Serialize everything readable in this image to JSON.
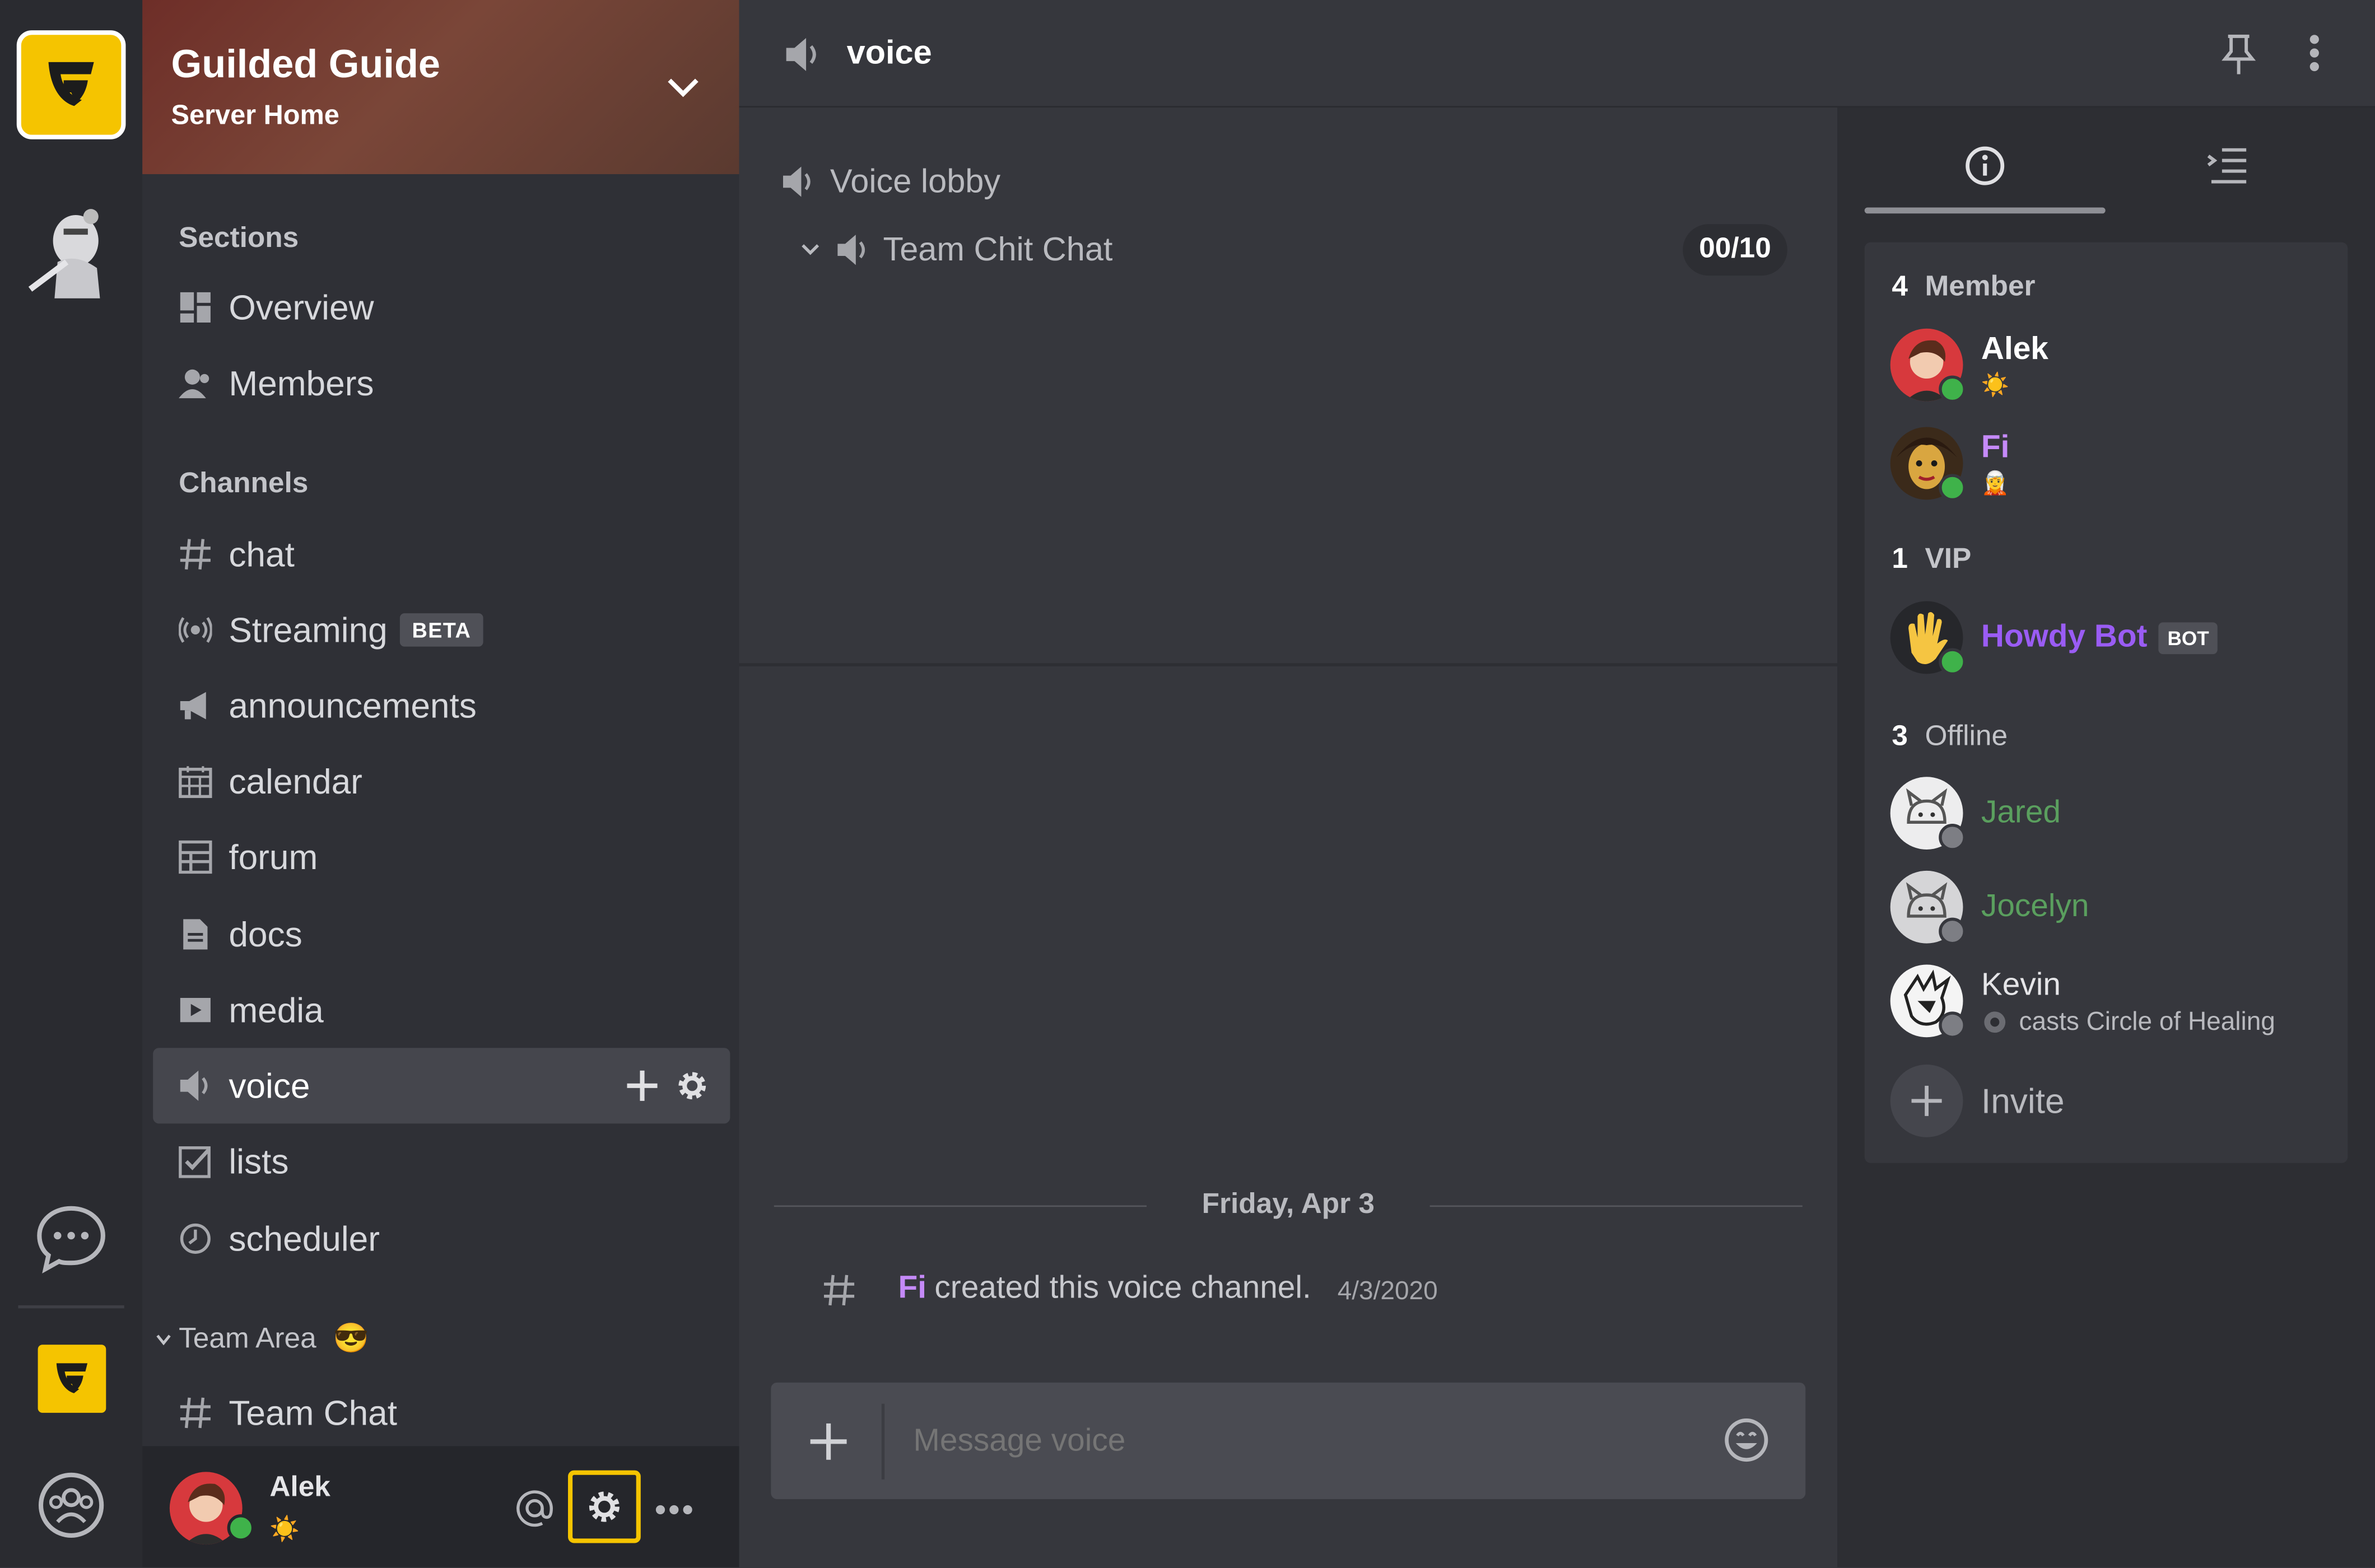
{
  "server": {
    "name": "Guilded Guide",
    "subtitle": "Server Home"
  },
  "sidebar": {
    "sections_header": "Sections",
    "sections": [
      {
        "label": "Overview",
        "icon": "overview-icon"
      },
      {
        "label": "Members",
        "icon": "members-icon"
      }
    ],
    "channels_header": "Channels",
    "channels": [
      {
        "label": "chat",
        "icon": "hash-icon"
      },
      {
        "label": "Streaming",
        "icon": "streaming-icon",
        "badge": "BETA"
      },
      {
        "label": "announcements",
        "icon": "megaphone-icon"
      },
      {
        "label": "calendar",
        "icon": "calendar-icon"
      },
      {
        "label": "forum",
        "icon": "forum-icon"
      },
      {
        "label": "docs",
        "icon": "docs-icon"
      },
      {
        "label": "media",
        "icon": "media-icon"
      },
      {
        "label": "voice",
        "icon": "speaker-icon",
        "selected": true
      },
      {
        "label": "lists",
        "icon": "checkbox-icon"
      },
      {
        "label": "scheduler",
        "icon": "clock-icon"
      }
    ],
    "team_area": {
      "label": "Team Area",
      "emoji": "😎"
    },
    "team_channels": [
      {
        "label": "Team Chat",
        "icon": "hash-icon"
      }
    ]
  },
  "user": {
    "name": "Alek",
    "status_emoji": "☀️"
  },
  "topbar": {
    "channel": "voice"
  },
  "voice": {
    "lobby_label": "Voice lobby",
    "room_label": "Team Chit Chat",
    "room_count": "00/10"
  },
  "chat": {
    "date_divider": "Friday, Apr 3",
    "system_author": "Fi",
    "system_text": "created this voice channel.",
    "system_date": "4/3/2020"
  },
  "composer": {
    "placeholder": "Message voice"
  },
  "members": {
    "group_member": {
      "count": "4",
      "label": "Member"
    },
    "group_vip": {
      "count": "1",
      "label": "VIP"
    },
    "group_offline": {
      "count": "3",
      "label": "Offline"
    },
    "online": [
      {
        "name": "Alek",
        "status": "☀️"
      },
      {
        "name": "Fi",
        "status": "🧝"
      }
    ],
    "vip": [
      {
        "name": "Howdy Bot",
        "badge": "BOT"
      }
    ],
    "offline": [
      {
        "name": "Jared"
      },
      {
        "name": "Jocelyn"
      },
      {
        "name": "Kevin",
        "status": "casts Circle of Healing"
      }
    ],
    "invite_label": "Invite"
  },
  "colors": {
    "brand_yellow": "#f5c400",
    "online_green": "#3fb24a",
    "fi_purple": "#c58af9",
    "bot_purple": "#9a5cf4",
    "offline_green": "#5a9f5e"
  }
}
